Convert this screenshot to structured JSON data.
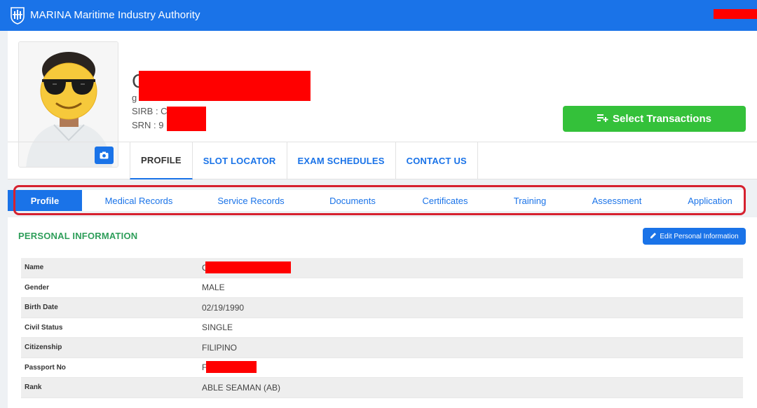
{
  "app": {
    "brand": "MARINA Maritime Industry Authority"
  },
  "profile": {
    "name_initial": "C",
    "email_prefix": "g",
    "sirb_label": "SIRB : C",
    "srn_label": "SRN : 9",
    "select_transactions": "Select Transactions"
  },
  "main_tabs": [
    "PROFILE",
    "SLOT LOCATOR",
    "EXAM SCHEDULES",
    "CONTACT US"
  ],
  "sub_tabs": [
    "Profile",
    "Medical Records",
    "Service Records",
    "Documents",
    "Certificates",
    "Training",
    "Assessment",
    "Application"
  ],
  "personal": {
    "title": "PERSONAL INFORMATION",
    "edit_label": "Edit Personal Information",
    "rows": [
      {
        "label": "Name",
        "value": "C"
      },
      {
        "label": "Gender",
        "value": "MALE"
      },
      {
        "label": "Birth Date",
        "value": "02/19/1990"
      },
      {
        "label": "Civil Status",
        "value": "SINGLE"
      },
      {
        "label": "Citizenship",
        "value": "FILIPINO"
      },
      {
        "label": "Passport No",
        "value": "F"
      },
      {
        "label": "Rank",
        "value": "ABLE SEAMAN (AB)"
      }
    ]
  },
  "colors": {
    "primary": "#1a73e8",
    "success": "#34c13a",
    "section_title": "#2e9e5a",
    "highlight": "#d6212f",
    "redaction": "#ff0000"
  },
  "icons": {
    "logo": "marina-logo-icon",
    "camera": "camera-icon",
    "transactions": "playlist-add-icon",
    "edit": "pencil-icon"
  }
}
